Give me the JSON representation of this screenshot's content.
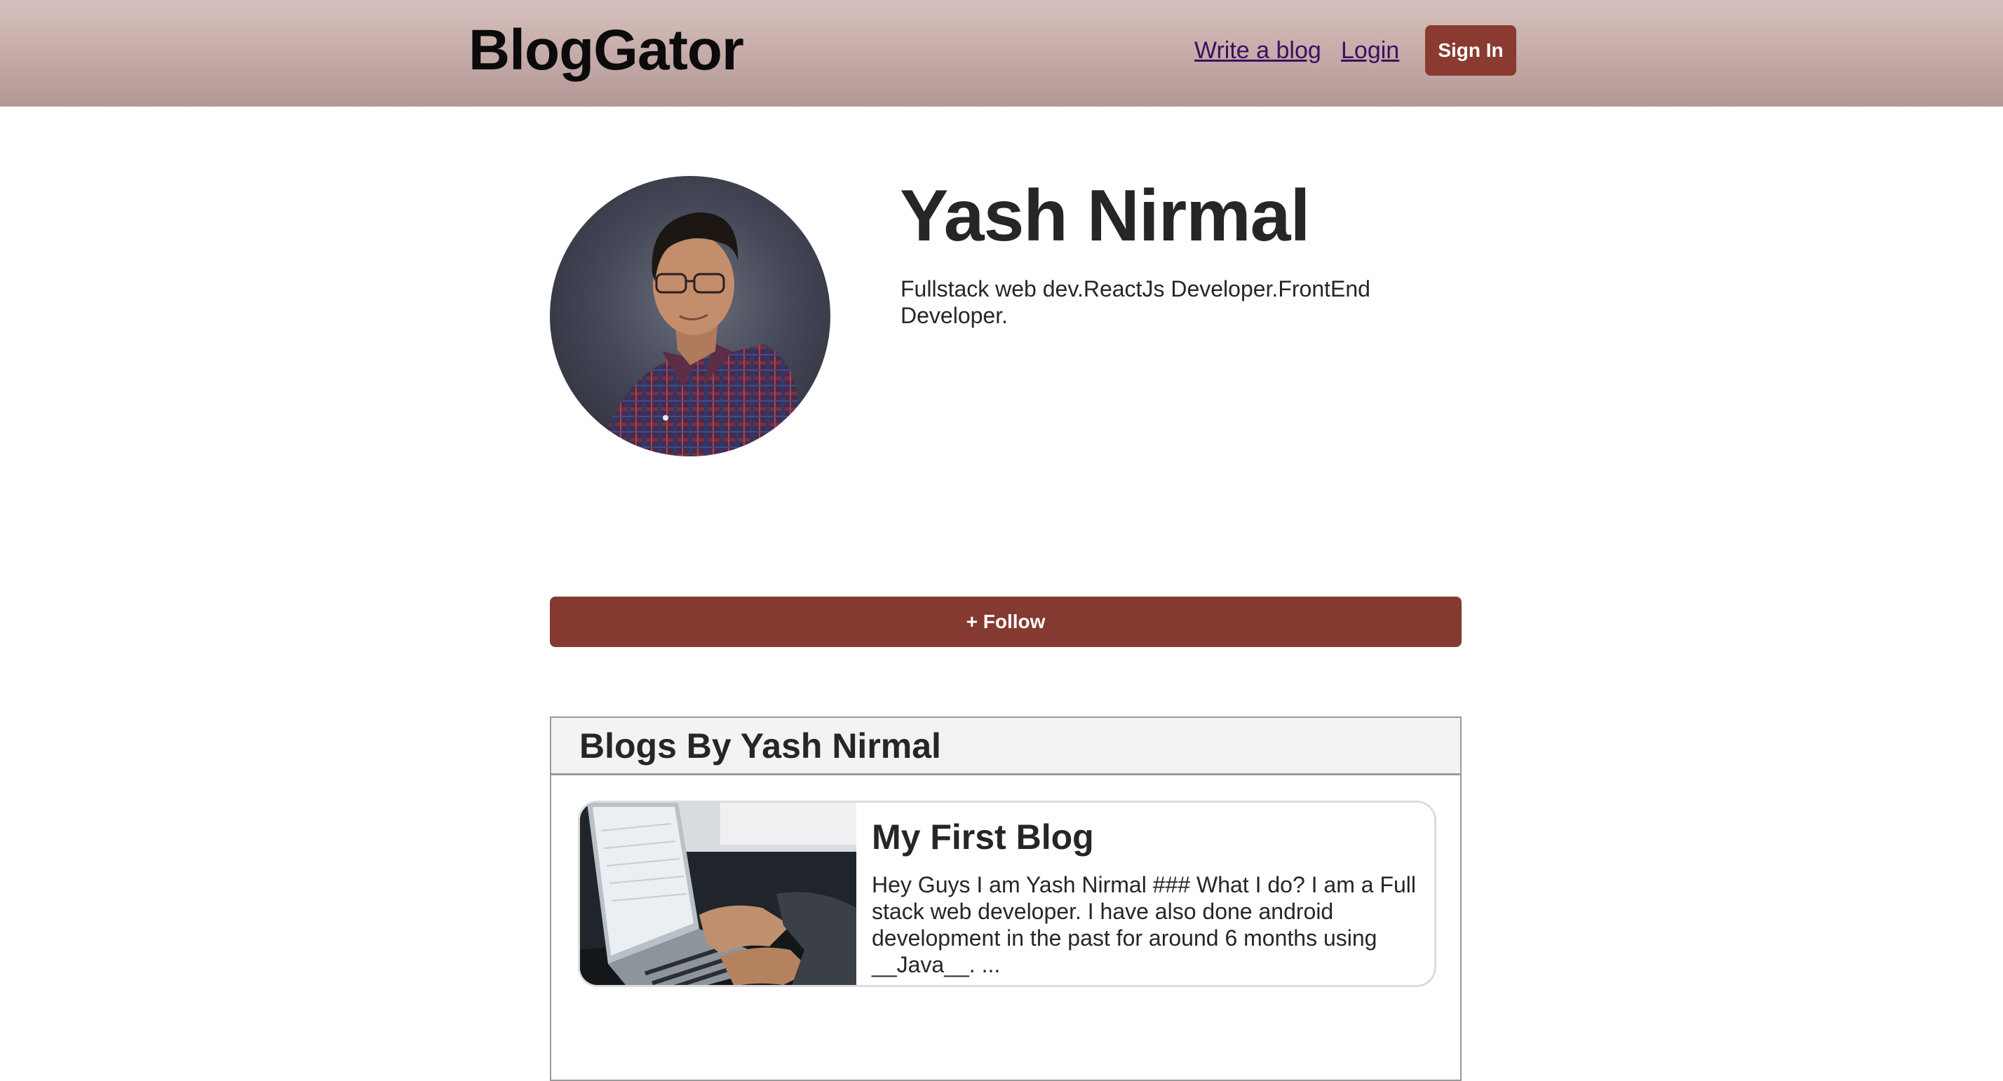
{
  "header": {
    "logo": "BlogGator",
    "nav": {
      "write_blog": "Write a blog",
      "login": "Login",
      "sign_in": "Sign In"
    }
  },
  "profile": {
    "avatar_icon": "profile-photo",
    "name": "Yash Nirmal",
    "bio": "Fullstack web dev.ReactJs Developer.FrontEnd Developer.",
    "follow_label": "+ Follow"
  },
  "blogs": {
    "heading": "Blogs By Yash Nirmal",
    "items": [
      {
        "title": "My First Blog",
        "excerpt": "Hey Guys I am Yash Nirmal ### What I do? I am a Full stack web developer. I have also done android development in the past for around 6 months using __Java__. ...",
        "thumbnail_icon": "laptop-typing-photo"
      }
    ]
  },
  "colors": {
    "header_top": "#d6c0bd",
    "header_bottom": "#b29896",
    "accent": "#843a31",
    "link": "#3b1060",
    "panel_header_bg": "#f3f3f3",
    "border": "#9a9a9a"
  }
}
